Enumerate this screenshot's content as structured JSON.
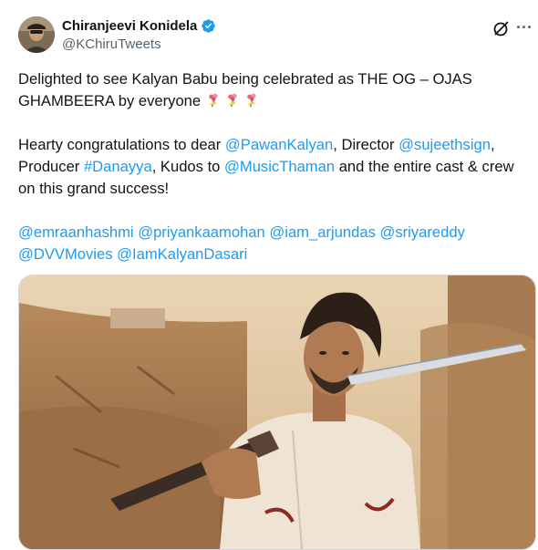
{
  "author": {
    "name": "Chiranjeevi Konidela",
    "handle": "@KChiruTweets",
    "verified": true,
    "verified_color": "#1d9bf0"
  },
  "actions": {
    "grok_icon": "grok-icon",
    "more_label": "···"
  },
  "tweet": {
    "line1_text": "Delighted to see Kalyan Babu being celebrated as THE OG – OJAS GHAMBEERA by everyone ",
    "emoji_name": "bouquet-icon",
    "p2": {
      "t1": "Hearty congratulations to dear ",
      "m1": "@PawanKalyan",
      "t2": ", Director ",
      "m2": "@sujeethsign",
      "t3": ", Producer ",
      "h1": "#Danayya",
      "t4": ", Kudos to ",
      "m3": "@MusicThaman",
      "t5": " and the entire cast & crew on this grand success!"
    },
    "mentions": [
      "@emraanhashmi",
      "@priyankaamohan",
      "@iam_arjundas",
      "@sriyareddy",
      "@DVVMovies",
      "@IamKalyanDasari"
    ]
  },
  "colors": {
    "link": "#1d9bf0",
    "text": "#0f1419",
    "secondary": "#536471"
  }
}
